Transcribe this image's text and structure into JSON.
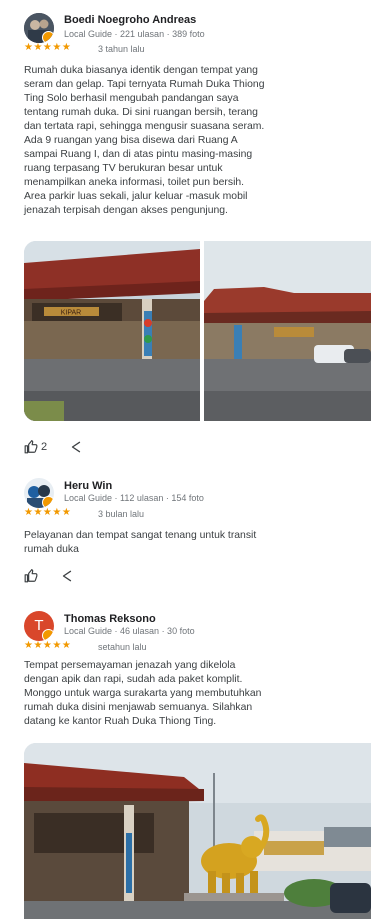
{
  "reviews": [
    {
      "name": "Boedi Noegroho Andreas",
      "meta": "Local Guide · 221 ulasan · 389 foto",
      "stars": "★★★★★",
      "date": "3 tahun lalu",
      "lines": [
        "Rumah duka biasanya identik dengan tempat yang",
        "seram dan gelap. Tapi ternyata Rumah Duka Thiong",
        "Ting Solo berhasil mengubah pandangan saya",
        "tentang rumah duka. Di sini ruangan bersih, terang",
        "dan tertata rapi, sehingga mengusir suasana seram.",
        "Ada 9 ruangan yang bisa disewa dari Ruang A",
        "sampai Ruang I, dan di atas pintu masing-masing",
        "ruang terpasang TV berukuran besar untuk",
        "menampilkan aneka informasi, toilet pun bersih.",
        "Area parkir luas sekali, jalur keluar -masuk mobil",
        "jenazah terpisah dengan akses pengunjung."
      ],
      "like_count": "2",
      "sign_text": "KIPAR"
    },
    {
      "name": "Heru Win",
      "meta": "Local Guide · 112 ulasan · 154 foto",
      "stars": "★★★★★",
      "date": "3 bulan lalu",
      "lines": [
        "Pelayanan dan tempat sangat tenang untuk transit",
        "rumah duka"
      ]
    },
    {
      "name": "Thomas Reksono",
      "meta": "Local Guide · 46 ulasan · 30 foto",
      "stars": "★★★★★",
      "date": "setahun lalu",
      "avatar_letter": "T",
      "lines": [
        "Tempat persemayaman jenazah yang dikelola",
        "dengan apik dan rapi, sudah ada paket komplit.",
        "Monggo untuk warga surakarta yang membutuhkan",
        "rumah duka disini menjawab semuanya. Silahkan",
        "datang ke kantor Ruah Duka Thiong Ting."
      ]
    }
  ],
  "colors": {
    "star": "#f29900",
    "meta_text": "#70757a",
    "avatar_red": "#d9472b"
  },
  "icons": [
    "thumbs-up-icon",
    "share-icon"
  ]
}
